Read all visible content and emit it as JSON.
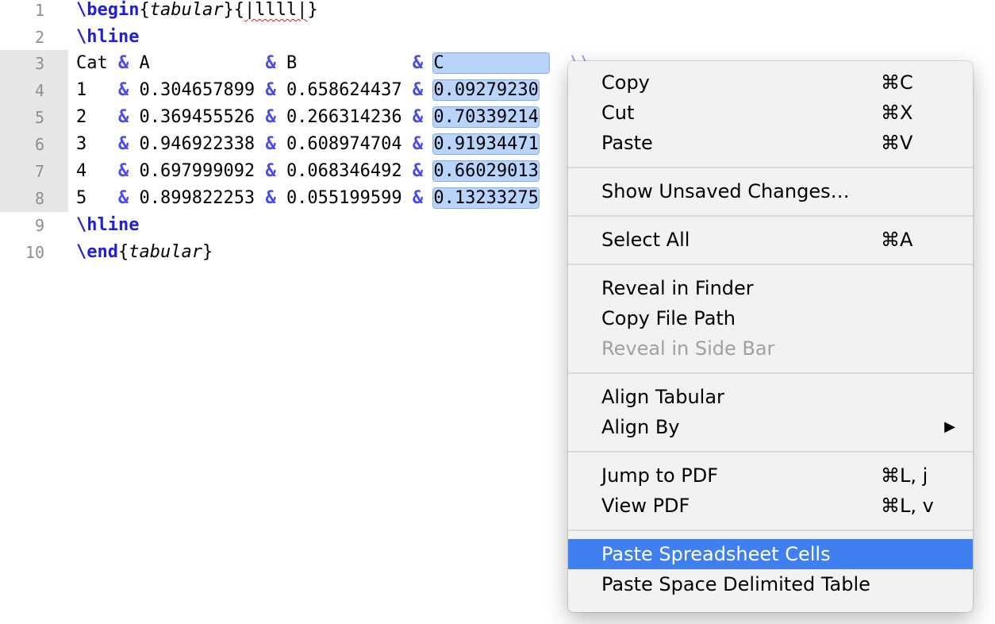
{
  "editor": {
    "line_numbers": [
      "1",
      "2",
      "3",
      "4",
      "5",
      "6",
      "7",
      "8",
      "9",
      "10"
    ],
    "line1": {
      "cmd": "\\begin",
      "brace_open": "{",
      "arg": "tabular",
      "brace_mid": "}{",
      "spec": "|llll|",
      "brace_close": "}"
    },
    "line2": {
      "cmd": "\\hline"
    },
    "header_row": {
      "c1": "Cat ",
      "c2": "A           ",
      "c3": "B           ",
      "c4": "C",
      "tail": "\\\\"
    },
    "rows": [
      {
        "cat": "1   ",
        "a": "0.304657899",
        "b": "0.658624437",
        "c": "0.09279230"
      },
      {
        "cat": "2   ",
        "a": "0.369455526",
        "b": "0.266314236",
        "c": "0.70339214"
      },
      {
        "cat": "3   ",
        "a": "0.946922338",
        "b": "0.608974704",
        "c": "0.91934471"
      },
      {
        "cat": "4   ",
        "a": "0.697999092",
        "b": "0.068346492",
        "c": "0.66029013"
      },
      {
        "cat": "5   ",
        "a": "0.899822253",
        "b": "0.055199599",
        "c": "0.13233275"
      }
    ],
    "amp": "&",
    "line9": {
      "cmd": "\\hline"
    },
    "line10": {
      "cmd": "\\end",
      "brace_open": "{",
      "arg": "tabular",
      "brace_close": "}"
    }
  },
  "context_menu": {
    "copy": {
      "label": "Copy",
      "shortcut": "⌘C"
    },
    "cut": {
      "label": "Cut",
      "shortcut": "⌘X"
    },
    "paste": {
      "label": "Paste",
      "shortcut": "⌘V"
    },
    "show_unsaved": {
      "label": "Show Unsaved Changes…"
    },
    "select_all": {
      "label": "Select All",
      "shortcut": "⌘A"
    },
    "reveal_finder": {
      "label": "Reveal in Finder"
    },
    "copy_path": {
      "label": "Copy File Path"
    },
    "reveal_sidebar": {
      "label": "Reveal in Side Bar"
    },
    "align_tabular": {
      "label": "Align Tabular"
    },
    "align_by": {
      "label": "Align By",
      "arrow": "▶"
    },
    "jump_pdf": {
      "label": "Jump to PDF",
      "shortcut": "⌘L, j"
    },
    "view_pdf": {
      "label": "View PDF",
      "shortcut": "⌘L, v"
    },
    "paste_cells": {
      "label": "Paste Spreadsheet Cells"
    },
    "paste_space": {
      "label": "Paste Space Delimited Table"
    }
  }
}
